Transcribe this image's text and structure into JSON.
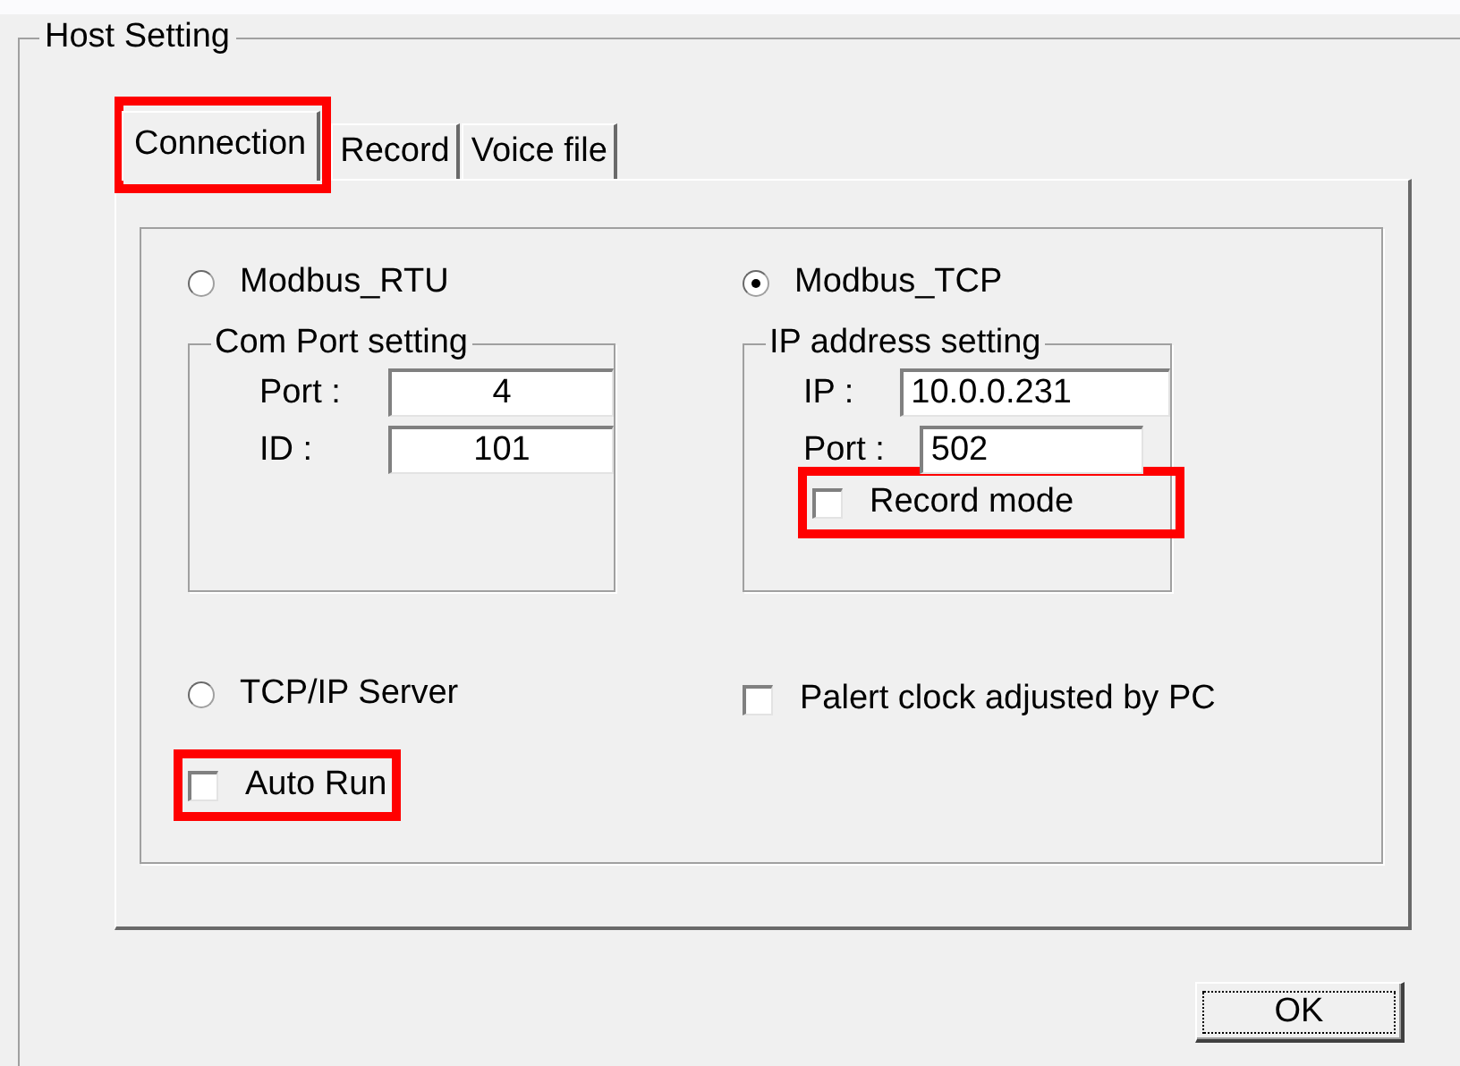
{
  "group": {
    "title": "Host Setting"
  },
  "tabs": [
    {
      "label": "Connection",
      "selected": true,
      "highlighted": true
    },
    {
      "label": "Record",
      "selected": false,
      "highlighted": false
    },
    {
      "label": "Voice file",
      "selected": false,
      "highlighted": false
    }
  ],
  "modes": [
    {
      "label": "Modbus_RTU",
      "selected": false
    },
    {
      "label": "Modbus_TCP",
      "selected": true
    },
    {
      "label": "TCP/IP Server",
      "selected": false
    }
  ],
  "com_port": {
    "title": "Com Port setting",
    "fields": [
      {
        "label": "Port :",
        "value": "4"
      },
      {
        "label": "ID :",
        "value": "101"
      }
    ]
  },
  "ip_address": {
    "title": "IP address setting",
    "fields": [
      {
        "label": "IP :",
        "value": "10.0.0.231"
      },
      {
        "label": "Port :",
        "value": "502"
      }
    ]
  },
  "checkboxes": [
    {
      "label": "Record mode",
      "checked": false,
      "highlighted": true
    },
    {
      "label": "Palert clock adjusted by PC",
      "checked": false,
      "highlighted": false
    },
    {
      "label": "Auto Run",
      "checked": false,
      "highlighted": true
    }
  ],
  "buttons": [
    {
      "label": "OK"
    }
  ]
}
